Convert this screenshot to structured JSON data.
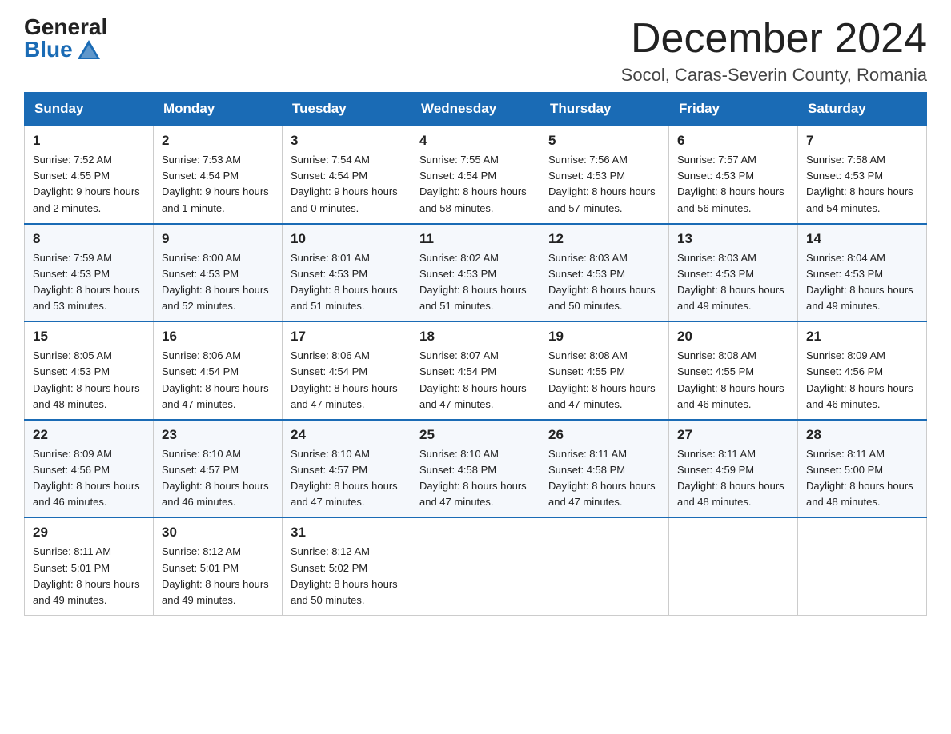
{
  "logo": {
    "general": "General",
    "blue": "Blue"
  },
  "title": "December 2024",
  "location": "Socol, Caras-Severin County, Romania",
  "days_of_week": [
    "Sunday",
    "Monday",
    "Tuesday",
    "Wednesday",
    "Thursday",
    "Friday",
    "Saturday"
  ],
  "weeks": [
    [
      {
        "num": "1",
        "sunrise": "7:52 AM",
        "sunset": "4:55 PM",
        "daylight": "9 hours and 2 minutes."
      },
      {
        "num": "2",
        "sunrise": "7:53 AM",
        "sunset": "4:54 PM",
        "daylight": "9 hours and 1 minute."
      },
      {
        "num": "3",
        "sunrise": "7:54 AM",
        "sunset": "4:54 PM",
        "daylight": "9 hours and 0 minutes."
      },
      {
        "num": "4",
        "sunrise": "7:55 AM",
        "sunset": "4:54 PM",
        "daylight": "8 hours and 58 minutes."
      },
      {
        "num": "5",
        "sunrise": "7:56 AM",
        "sunset": "4:53 PM",
        "daylight": "8 hours and 57 minutes."
      },
      {
        "num": "6",
        "sunrise": "7:57 AM",
        "sunset": "4:53 PM",
        "daylight": "8 hours and 56 minutes."
      },
      {
        "num": "7",
        "sunrise": "7:58 AM",
        "sunset": "4:53 PM",
        "daylight": "8 hours and 54 minutes."
      }
    ],
    [
      {
        "num": "8",
        "sunrise": "7:59 AM",
        "sunset": "4:53 PM",
        "daylight": "8 hours and 53 minutes."
      },
      {
        "num": "9",
        "sunrise": "8:00 AM",
        "sunset": "4:53 PM",
        "daylight": "8 hours and 52 minutes."
      },
      {
        "num": "10",
        "sunrise": "8:01 AM",
        "sunset": "4:53 PM",
        "daylight": "8 hours and 51 minutes."
      },
      {
        "num": "11",
        "sunrise": "8:02 AM",
        "sunset": "4:53 PM",
        "daylight": "8 hours and 51 minutes."
      },
      {
        "num": "12",
        "sunrise": "8:03 AM",
        "sunset": "4:53 PM",
        "daylight": "8 hours and 50 minutes."
      },
      {
        "num": "13",
        "sunrise": "8:03 AM",
        "sunset": "4:53 PM",
        "daylight": "8 hours and 49 minutes."
      },
      {
        "num": "14",
        "sunrise": "8:04 AM",
        "sunset": "4:53 PM",
        "daylight": "8 hours and 49 minutes."
      }
    ],
    [
      {
        "num": "15",
        "sunrise": "8:05 AM",
        "sunset": "4:53 PM",
        "daylight": "8 hours and 48 minutes."
      },
      {
        "num": "16",
        "sunrise": "8:06 AM",
        "sunset": "4:54 PM",
        "daylight": "8 hours and 47 minutes."
      },
      {
        "num": "17",
        "sunrise": "8:06 AM",
        "sunset": "4:54 PM",
        "daylight": "8 hours and 47 minutes."
      },
      {
        "num": "18",
        "sunrise": "8:07 AM",
        "sunset": "4:54 PM",
        "daylight": "8 hours and 47 minutes."
      },
      {
        "num": "19",
        "sunrise": "8:08 AM",
        "sunset": "4:55 PM",
        "daylight": "8 hours and 47 minutes."
      },
      {
        "num": "20",
        "sunrise": "8:08 AM",
        "sunset": "4:55 PM",
        "daylight": "8 hours and 46 minutes."
      },
      {
        "num": "21",
        "sunrise": "8:09 AM",
        "sunset": "4:56 PM",
        "daylight": "8 hours and 46 minutes."
      }
    ],
    [
      {
        "num": "22",
        "sunrise": "8:09 AM",
        "sunset": "4:56 PM",
        "daylight": "8 hours and 46 minutes."
      },
      {
        "num": "23",
        "sunrise": "8:10 AM",
        "sunset": "4:57 PM",
        "daylight": "8 hours and 46 minutes."
      },
      {
        "num": "24",
        "sunrise": "8:10 AM",
        "sunset": "4:57 PM",
        "daylight": "8 hours and 47 minutes."
      },
      {
        "num": "25",
        "sunrise": "8:10 AM",
        "sunset": "4:58 PM",
        "daylight": "8 hours and 47 minutes."
      },
      {
        "num": "26",
        "sunrise": "8:11 AM",
        "sunset": "4:58 PM",
        "daylight": "8 hours and 47 minutes."
      },
      {
        "num": "27",
        "sunrise": "8:11 AM",
        "sunset": "4:59 PM",
        "daylight": "8 hours and 48 minutes."
      },
      {
        "num": "28",
        "sunrise": "8:11 AM",
        "sunset": "5:00 PM",
        "daylight": "8 hours and 48 minutes."
      }
    ],
    [
      {
        "num": "29",
        "sunrise": "8:11 AM",
        "sunset": "5:01 PM",
        "daylight": "8 hours and 49 minutes."
      },
      {
        "num": "30",
        "sunrise": "8:12 AM",
        "sunset": "5:01 PM",
        "daylight": "8 hours and 49 minutes."
      },
      {
        "num": "31",
        "sunrise": "8:12 AM",
        "sunset": "5:02 PM",
        "daylight": "8 hours and 50 minutes."
      },
      null,
      null,
      null,
      null
    ]
  ],
  "labels": {
    "sunrise": "Sunrise:",
    "sunset": "Sunset:",
    "daylight": "Daylight:"
  }
}
